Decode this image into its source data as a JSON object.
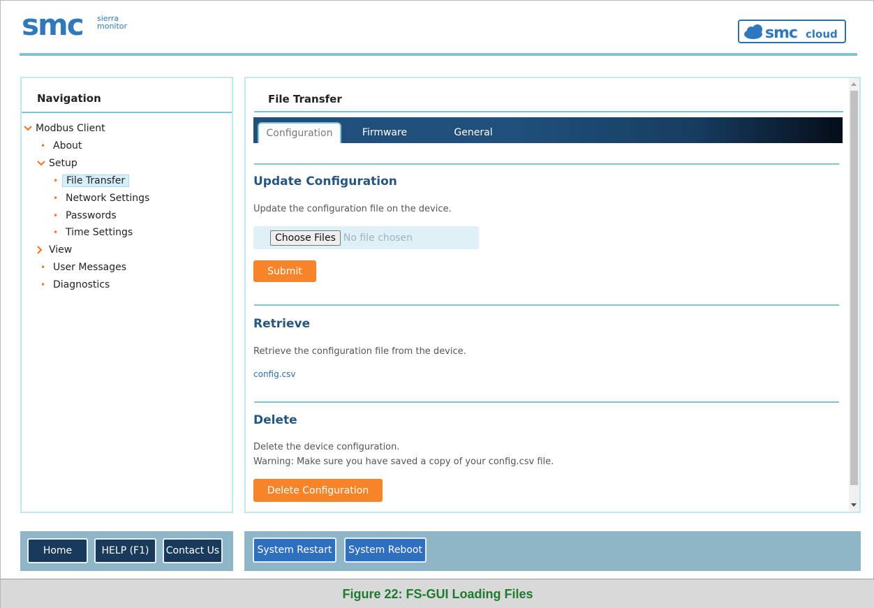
{
  "header": {
    "logo_text": "SMC sierra monitor",
    "cloud_logo_text": "SMC cloud"
  },
  "navigation": {
    "title": "Navigation",
    "items": [
      {
        "label": "Modbus Client",
        "marker": "chevron-down"
      },
      {
        "label": "About",
        "marker": "bullet"
      },
      {
        "label": "Setup",
        "marker": "chevron-down"
      },
      {
        "label": "File Transfer",
        "marker": "bullet",
        "selected": true
      },
      {
        "label": "Network Settings",
        "marker": "bullet"
      },
      {
        "label": "Passwords",
        "marker": "bullet"
      },
      {
        "label": "Time Settings",
        "marker": "bullet"
      },
      {
        "label": "View",
        "marker": "chevron-right"
      },
      {
        "label": "User Messages",
        "marker": "bullet"
      },
      {
        "label": "Diagnostics",
        "marker": "bullet"
      }
    ]
  },
  "main": {
    "title": "File Transfer",
    "tabs": [
      {
        "label": "Configuration",
        "active": true
      },
      {
        "label": "Firmware",
        "active": false
      },
      {
        "label": "General",
        "active": false
      }
    ],
    "update": {
      "title": "Update Configuration",
      "description": "Update the configuration file on the device.",
      "choose_label": "Choose Files",
      "no_file_text": "No file chosen",
      "submit_label": "Submit"
    },
    "retrieve": {
      "title": "Retrieve",
      "description": "Retrieve the configuration file from the device.",
      "file_link": "config.csv"
    },
    "delete": {
      "title": "Delete",
      "description": "Delete the device configuration.",
      "warning": "Warning: Make sure you have saved a copy of your config.csv file.",
      "button_label": "Delete Configuration"
    }
  },
  "footer": {
    "left_buttons": [
      "Home",
      "HELP (F1)",
      "Contact Us"
    ],
    "right_buttons": [
      "System Restart",
      "System Reboot"
    ]
  },
  "caption": "Figure 22: FS-GUI Loading Files",
  "colors": {
    "accent_orange": "#f8842a",
    "navy": "#1a3a5c",
    "section_title": "#26557d",
    "caption_green": "#1d7a2f"
  }
}
